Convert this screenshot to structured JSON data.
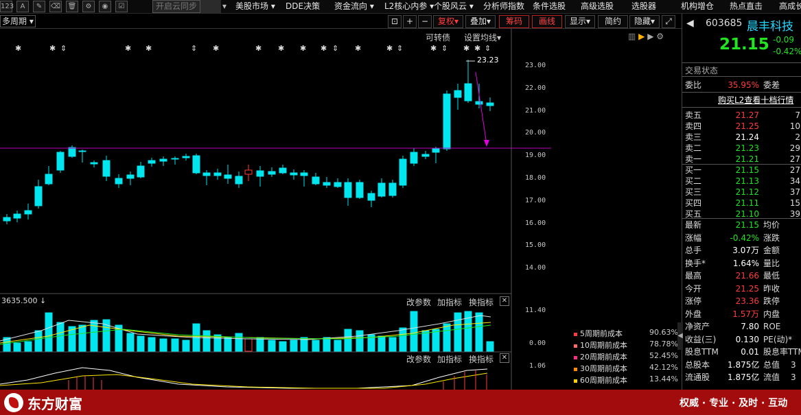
{
  "toolbar_icons": [
    "123",
    "A",
    "pen",
    "eraser",
    "trash",
    "gear",
    "eye",
    "sync"
  ],
  "sync_label": "开启云同步",
  "menu": [
    "美股市场",
    "DDE决策",
    "资金流向",
    "L2核心内参",
    "个股风云",
    "分析师指数",
    "条件选股",
    "高级选股",
    "选股器",
    "机构增仓",
    "热点直击",
    "高成长"
  ],
  "period_label": "多周期",
  "chart_controls": {
    "fuquan": "复权",
    "overlay": "叠加",
    "chouma": "筹码",
    "huaxian": "画线",
    "display": "显示",
    "jianyue": "简约",
    "hide": "隐藏"
  },
  "kezhuanzhai": "可转债",
  "set_ma": "设置均线",
  "high_marker": "23.23",
  "price_axis": [
    "23.00",
    "22.00",
    "21.00",
    "20.00",
    "19.00",
    "18.00",
    "17.00",
    "16.00",
    "15.00",
    "14.00"
  ],
  "volume_panel": {
    "value": "3635.500",
    "btn_change": "改参数",
    "btn_add": "加指标",
    "btn_switch": "换指标",
    "axis_top": "11.40",
    "axis_bottom": "0.00"
  },
  "macd_panel": {
    "btn_change": "改参数",
    "btn_add": "加指标",
    "btn_switch": "换指标",
    "axis_top": "1.06"
  },
  "chip_legend": [
    {
      "label": "5周期前成本",
      "pct": "90.63%",
      "color": "#ff3c3c"
    },
    {
      "label": "10周期前成本",
      "pct": "78.78%",
      "color": "#ff6b6b"
    },
    {
      "label": "20周期前成本",
      "pct": "52.45%",
      "color": "#ff2d8a"
    },
    {
      "label": "30周期前成本",
      "pct": "42.12%",
      "color": "#ff8c00"
    },
    {
      "label": "60周期前成本",
      "pct": "13.44%",
      "color": "#ffd000"
    }
  ],
  "stock": {
    "code": "603685",
    "name": "晨丰科技",
    "price": "21.15",
    "change": "-0.09",
    "change_pct": "-0.42%",
    "trade_status": "交易状态",
    "weibi_label": "委比",
    "weibi": "35.95%",
    "weicha_label": "委差",
    "l2_link": "购买L2查看十档行情",
    "asks": [
      {
        "label": "卖五",
        "price": "21.27",
        "vol": "7"
      },
      {
        "label": "卖四",
        "price": "21.25",
        "vol": "10"
      },
      {
        "label": "卖三",
        "price": "21.24",
        "vol": "2"
      },
      {
        "label": "卖二",
        "price": "21.23",
        "vol": "29"
      },
      {
        "label": "卖一",
        "price": "21.21",
        "vol": "27"
      }
    ],
    "bids": [
      {
        "label": "买一",
        "price": "21.15",
        "vol": "27"
      },
      {
        "label": "买二",
        "price": "21.13",
        "vol": "34"
      },
      {
        "label": "买三",
        "price": "21.12",
        "vol": "37"
      },
      {
        "label": "买四",
        "price": "21.11",
        "vol": "15"
      },
      {
        "label": "买五",
        "price": "21.10",
        "vol": "39"
      }
    ],
    "stats": [
      {
        "k": "最新",
        "v": "21.15",
        "vc": "green",
        "k2": "均价",
        "v2": ""
      },
      {
        "k": "涨幅",
        "v": "-0.42%",
        "vc": "green",
        "k2": "涨跌",
        "v2": ""
      },
      {
        "k": "总手",
        "v": "3.07万",
        "vc": "white",
        "k2": "金额",
        "v2": ""
      },
      {
        "k": "换手*",
        "v": "1.64%",
        "vc": "white",
        "k2": "量比",
        "v2": ""
      },
      {
        "k": "最高",
        "v": "21.66",
        "vc": "red",
        "k2": "最低",
        "v2": ""
      },
      {
        "k": "今开",
        "v": "21.25",
        "vc": "red",
        "k2": "昨收",
        "v2": ""
      },
      {
        "k": "涨停",
        "v": "23.36",
        "vc": "red",
        "k2": "跌停",
        "v2": ""
      },
      {
        "k": "外盘",
        "v": "1.57万",
        "vc": "red",
        "k2": "内盘",
        "v2": ""
      },
      {
        "k": "净资产",
        "v": "7.80",
        "vc": "white",
        "k2": "ROE",
        "v2": ""
      },
      {
        "k": "收益(三)",
        "v": "0.130",
        "vc": "white",
        "k2": "PE(动)*",
        "v2": ""
      },
      {
        "k": "股息TTM",
        "v": "0.01",
        "vc": "white",
        "k2": "股息率TTM",
        "v2": ""
      },
      {
        "k": "总股本",
        "v": "1.875亿",
        "vc": "white",
        "k2": "总值",
        "v2": "3"
      },
      {
        "k": "流通股",
        "v": "1.875亿",
        "vc": "white",
        "k2": "流值",
        "v2": "3"
      }
    ]
  },
  "brand": "东方财富",
  "slogan": "权威 · 专业 · 及时 · 互动",
  "colors": {
    "up": "#ff3c3c",
    "down": "#00e5ee",
    "bg": "#000000",
    "footer": "#a30c0c",
    "magenta_line": "#c000c0"
  }
}
